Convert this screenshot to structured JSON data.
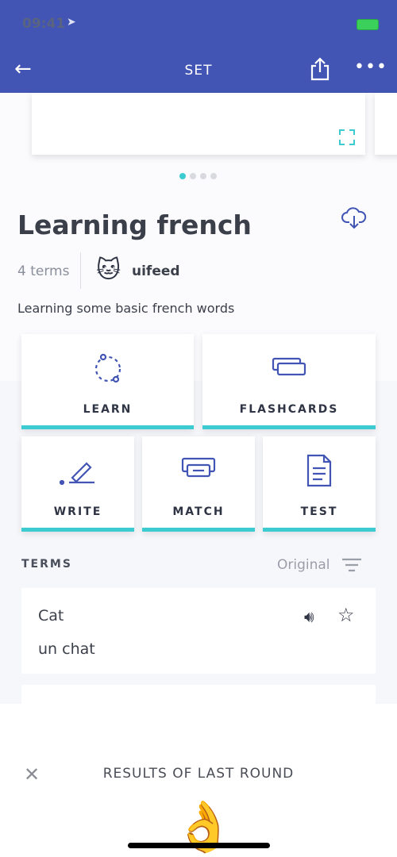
{
  "status": {
    "time": "09:41",
    "icons": [
      "location-arrow-icon",
      "battery-charging-icon"
    ]
  },
  "nav": {
    "title": "SET",
    "back": "arrow-left-icon",
    "share": "share-icon",
    "more": "more-icon"
  },
  "carousel": {
    "pages": 4,
    "active": 1
  },
  "set": {
    "title": "Learning french",
    "terms_count": "4 terms",
    "user": "uifeed",
    "description": "Learning some basic french words"
  },
  "modes": [
    {
      "label": "LEARN"
    },
    {
      "label": "FLASHCARDS"
    },
    {
      "label": "WRITE"
    },
    {
      "label": "MATCH"
    },
    {
      "label": "TEST"
    }
  ],
  "terms": {
    "heading": "TERMS",
    "sort": "Original",
    "items": [
      {
        "term": "Cat",
        "definition": "un chat"
      }
    ]
  },
  "sheet": {
    "title": "RESULTS OF LAST ROUND",
    "emoji": "👌"
  },
  "colors": {
    "brand": "#4255b4",
    "accent": "#3ccbd0"
  }
}
